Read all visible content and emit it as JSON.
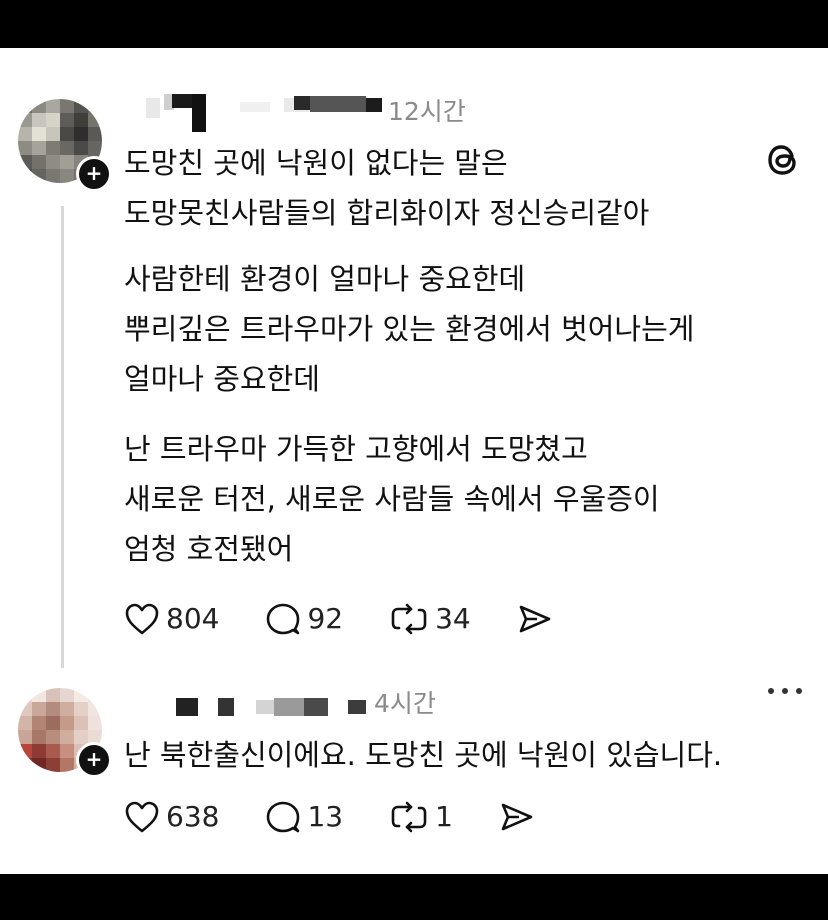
{
  "post": {
    "time": "12시간",
    "paragraphs": [
      [
        "도망친 곳에 낙원이 없다는 말은",
        "도망못친사람들의 합리화이자 정신승리같아"
      ],
      [
        "사람한테 환경이 얼마나 중요한데",
        "뿌리깊은 트라우마가 있는 환경에서 벗어나는게",
        "얼마나 중요한데"
      ],
      [
        "난 트라우마 가득한 고향에서 도망쳤고",
        "새로운 터전, 새로운 사람들 속에서 우울증이",
        "엄청 호전됐어"
      ]
    ],
    "likes": "804",
    "comments": "92",
    "reposts": "34"
  },
  "reply": {
    "time": "4시간",
    "text": "난 북한출신이에요. 도망친 곳에 낙원이 있습니다.",
    "likes": "638",
    "comments": "13",
    "reposts": "1"
  },
  "icons": {
    "header": "threads-logo-icon",
    "reply_menu": "more-options-icon",
    "like": "heart-icon",
    "comment": "comment-bubble-icon",
    "repost": "repost-icon",
    "share": "send-icon"
  }
}
